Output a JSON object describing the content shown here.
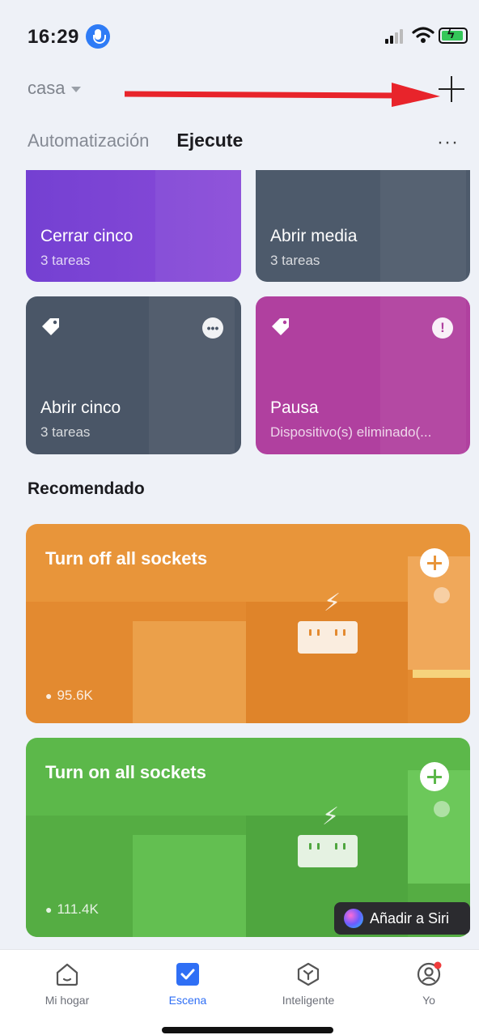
{
  "status_bar": {
    "time": "16:29"
  },
  "header": {
    "home_name": "casa",
    "tabs": [
      {
        "label": "Automatización",
        "active": false
      },
      {
        "label": "Ejecute",
        "active": true
      }
    ],
    "more_label": "···"
  },
  "scenes": [
    {
      "name": "Cerrar cinco",
      "sub": "3 tareas",
      "color": "#7b3fd6"
    },
    {
      "name": "Abrir media",
      "sub": "3 tareas",
      "color": "#4d5a6b"
    },
    {
      "name": "Abrir cinco",
      "sub": "3 tareas",
      "color": "#4a5667",
      "badge": "more-icon"
    },
    {
      "name": "Pausa",
      "sub": "Dispositivo(s) eliminado(...",
      "color": "#b0409f",
      "badge": "warning-icon"
    }
  ],
  "recommended": {
    "title": "Recomendado",
    "items": [
      {
        "title": "Turn off all sockets",
        "count": "95.6K",
        "color": "#e8953a"
      },
      {
        "title": "Turn on all sockets",
        "count": "111.4K",
        "color": "#5cb84a"
      }
    ],
    "siri_label": "Añadir a Siri"
  },
  "nav": [
    {
      "label": "Mi hogar",
      "icon": "home-icon",
      "active": false
    },
    {
      "label": "Escena",
      "icon": "scene-check-icon",
      "active": true
    },
    {
      "label": "Inteligente",
      "icon": "smart-icon",
      "active": false
    },
    {
      "label": "Yo",
      "icon": "profile-icon",
      "active": false,
      "notification": true
    }
  ]
}
